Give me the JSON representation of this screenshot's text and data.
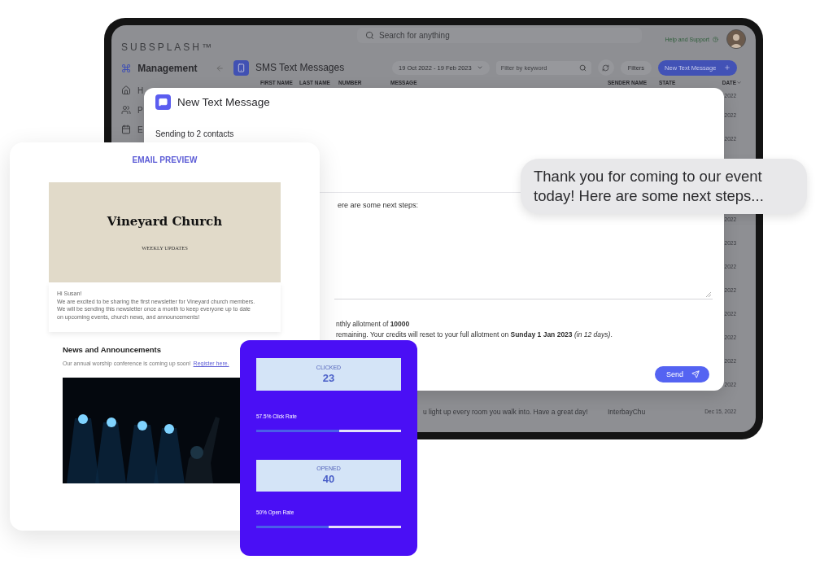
{
  "app": {
    "logo": "SUBSPLASH™",
    "search": {
      "placeholder": "Search for anything"
    },
    "help": "Help and Support",
    "sidebar": {
      "title": "Management",
      "items": [
        {
          "label": "H"
        },
        {
          "label": "P"
        },
        {
          "label": "E"
        }
      ]
    },
    "header": {
      "title": "SMS Text Messages",
      "date_range": "19 Oct 2022 - 19 Feb 2023",
      "filter": {
        "placeholder": "Filter by keyword"
      },
      "filters_button": "Filters",
      "new_button": "New Text Message"
    },
    "table": {
      "columns": [
        "FIRST NAME",
        "LAST NAME",
        "NUMBER",
        "MESSAGE",
        "SENDER NAME",
        "STATE",
        "DATE"
      ],
      "rows": [
        {
          "date": "2022"
        },
        {
          "date": "2022"
        },
        {
          "date": "2022"
        },
        {
          "date": "2022"
        },
        {
          "date": "2023"
        },
        {
          "date": "2022"
        },
        {
          "date": "2022"
        },
        {
          "date": "2022"
        },
        {
          "date": "2022"
        },
        {
          "date": "2022"
        },
        {
          "date": "2022"
        },
        {
          "message": "u light up every room you walk into. Have a great day!",
          "sender": "InterbayChu",
          "date": "Dec 15, 2022"
        }
      ]
    }
  },
  "modal": {
    "title": "New Text Message",
    "recipients": "Sending to 2 contacts",
    "message": "ere are some next steps:",
    "allotment": "nthly allotment of **10000**",
    "credits": "remaining. Your credits will reset to your full allotment on **Sunday 1 Jan 2023** *(in 12 days)*.",
    "send_button": "Send"
  },
  "bubble": {
    "text": "Thank you for coming to our event today! Here are some next steps..."
  },
  "email_preview": {
    "heading": "EMAIL PREVIEW",
    "banner_title": "Vineyard Church",
    "banner_subtitle": "WEEKLY UPDATES",
    "greeting": "Hi Susan!",
    "body": [
      "We are excited to be sharing the first newsletter for Vineyard church members.",
      "We will be sending this newsletter once a month to keep everyone up to date",
      "on upcoming events, church news, and announcements!"
    ],
    "news_title": "News and Announcements",
    "news_text": "Our annual worship conference is coming up soon!",
    "news_link": "Register here."
  },
  "stats": [
    {
      "label": "CLICKED",
      "value": "23",
      "rate": "57.5% Click Rate",
      "level": 0.575
    },
    {
      "label": "OPENED",
      "value": "40",
      "rate": "50% Open Rate",
      "level": 0.5
    }
  ]
}
